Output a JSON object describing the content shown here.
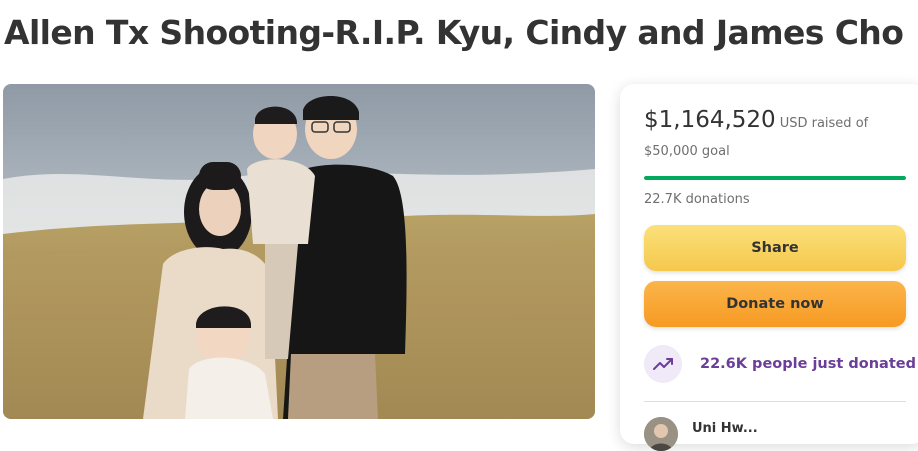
{
  "page": {
    "title": "Allen Tx Shooting-R.I.P. Kyu, Cindy and James Cho"
  },
  "hero": {
    "image_description_icon": "family-photo"
  },
  "donation_card": {
    "amount_raised": "$1,164,520",
    "raised_suffix": "USD raised of $50,000 goal",
    "progress_fraction": 1.0,
    "donation_count": "22.7K donations",
    "share_label": "Share",
    "donate_label": "Donate now",
    "recent_activity": "22.6K people just donated",
    "recent_icon": "trending-up-icon",
    "first_donor_name": "Uni Hw..."
  },
  "colors": {
    "progress": "#02a95c",
    "share_button": "#f8d35f",
    "donate_button": "#f7a532",
    "recent_text": "#6b3f98"
  }
}
